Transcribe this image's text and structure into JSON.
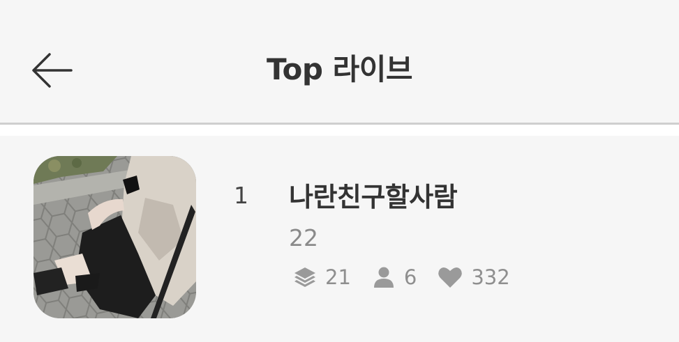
{
  "header": {
    "title": "Top 라이브",
    "back_icon": "arrow-left-icon"
  },
  "colors": {
    "background": "#f6f6f6",
    "divider": "#cfcfcf",
    "title_text": "#333333",
    "muted_text": "#8a8a8a"
  },
  "lives": [
    {
      "rank": "1",
      "title": "나란친구할사람",
      "subtitle": "22",
      "stats": {
        "layers": {
          "icon": "layers-icon",
          "value": "21"
        },
        "viewers": {
          "icon": "person-icon",
          "value": "6"
        },
        "likes": {
          "icon": "heart-icon",
          "value": "332"
        }
      }
    }
  ]
}
